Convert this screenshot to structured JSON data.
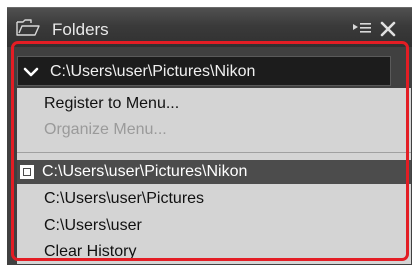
{
  "panel": {
    "title": "Folders",
    "icons": {
      "folder": "folder-outline-icon",
      "list_menu": "list-menu-icon",
      "close": "close-icon"
    }
  },
  "path_combo": {
    "value": "C:\\Users\\user\\Pictures\\Nikon",
    "icon": "chevron-down-icon"
  },
  "menu": {
    "register": "Register to Menu...",
    "organize": "Organize Menu...",
    "history": [
      {
        "label": "C:\\Users\\user\\Pictures\\Nikon",
        "selected": true
      },
      {
        "label": "C:\\Users\\user\\Pictures",
        "selected": false
      },
      {
        "label": "C:\\Users\\user",
        "selected": false
      }
    ],
    "clear_history": "Clear History"
  },
  "colors": {
    "header_bg": "#3a3a3a",
    "menu_bg": "#d4d4d4",
    "selected_bg": "#4c4c4c",
    "highlight_outline": "#e31d24"
  }
}
